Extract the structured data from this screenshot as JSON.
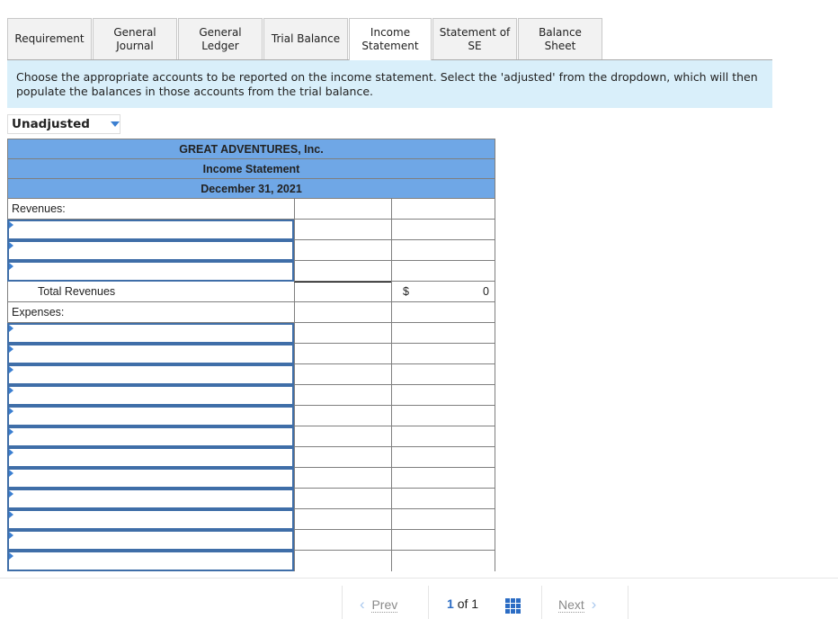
{
  "tabs": [
    {
      "label": "Requirement",
      "active": false
    },
    {
      "label": "General Journal",
      "active": false
    },
    {
      "label": "General Ledger",
      "active": false
    },
    {
      "label": "Trial Balance",
      "active": false
    },
    {
      "label": "Income Statement",
      "active": true
    },
    {
      "label": "Statement of SE",
      "active": false
    },
    {
      "label": "Balance Sheet",
      "active": false
    }
  ],
  "instructions": "Choose the appropriate accounts to be reported on the income statement. Select the 'adjusted' from the dropdown, which will then populate the balances in those accounts from the trial balance.",
  "dropdown": {
    "selected": "Unadjusted",
    "icon": "caret-down-icon"
  },
  "statement": {
    "company": "GREAT ADVENTURES, Inc.",
    "title": "Income Statement",
    "date": "December 31, 2021",
    "revenues_label": "Revenues:",
    "revenue_rows": 3,
    "total_revenues_label": "Total Revenues",
    "total_revenues_currency": "$",
    "total_revenues_value": "0",
    "expenses_label": "Expenses:",
    "expense_rows": 12
  },
  "footer": {
    "prev_label": "Prev",
    "next_label": "Next",
    "current_page": "1",
    "of_label": "of",
    "total_pages": "1",
    "prev_icon": "chevron-left-icon",
    "next_icon": "chevron-right-icon",
    "grid_icon": "grid-icon"
  }
}
